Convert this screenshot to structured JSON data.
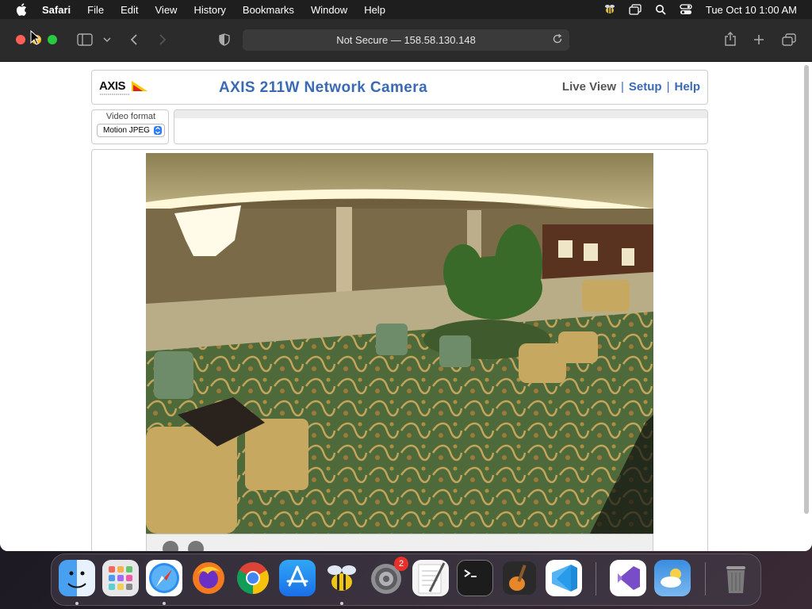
{
  "menubar": {
    "app_name": "Safari",
    "items": [
      "File",
      "Edit",
      "View",
      "History",
      "Bookmarks",
      "Window",
      "Help"
    ],
    "clock": "Tue Oct 10  1:00 AM",
    "status_icons": [
      "bee-icon",
      "screen-mirror-icon",
      "search-icon",
      "control-center-icon"
    ]
  },
  "browser": {
    "address": "Not Secure — 158.58.130.148"
  },
  "camera_page": {
    "title": "AXIS 211W Network Camera",
    "logo": "AXIS",
    "nav": {
      "live_view": "Live View",
      "separator": "|",
      "setup": "Setup",
      "help": "Help"
    },
    "video_format": {
      "label": "Video format",
      "selected": "Motion JPEG"
    }
  },
  "dock": {
    "apps": [
      "Finder",
      "Launchpad",
      "Safari",
      "Firefox",
      "Chrome",
      "App Store",
      "Bee",
      "System Settings",
      "TextEdit",
      "Terminal",
      "GarageBand",
      "Visual Studio Code",
      "Visual Studio",
      "Weather",
      "Trash"
    ],
    "settings_badge": "2"
  }
}
